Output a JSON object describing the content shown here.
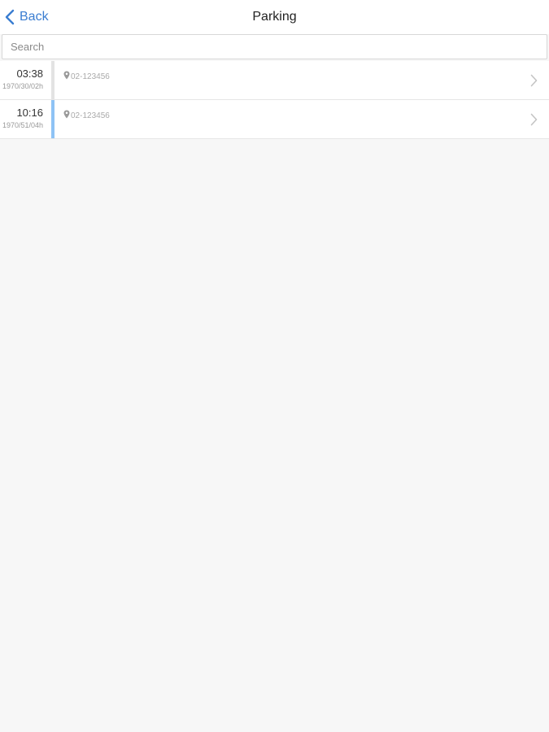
{
  "header": {
    "back_label": "Back",
    "title": "Parking"
  },
  "search": {
    "placeholder": "Search",
    "value": ""
  },
  "icons": {
    "back": "chevron-left-icon",
    "location": "map-pin-icon",
    "row_action": "chevron-right-icon"
  },
  "colors": {
    "accent": "#3a7dd1",
    "row_bar_default": "#e3e3e3",
    "row_bar_selected": "#8ec3f5"
  },
  "rows": [
    {
      "time": "03:38",
      "date": "1970/30/02h",
      "location": "02-123456",
      "selected": false
    },
    {
      "time": "10:16",
      "date": "1970/51/04h",
      "location": "02-123456",
      "selected": true
    }
  ]
}
